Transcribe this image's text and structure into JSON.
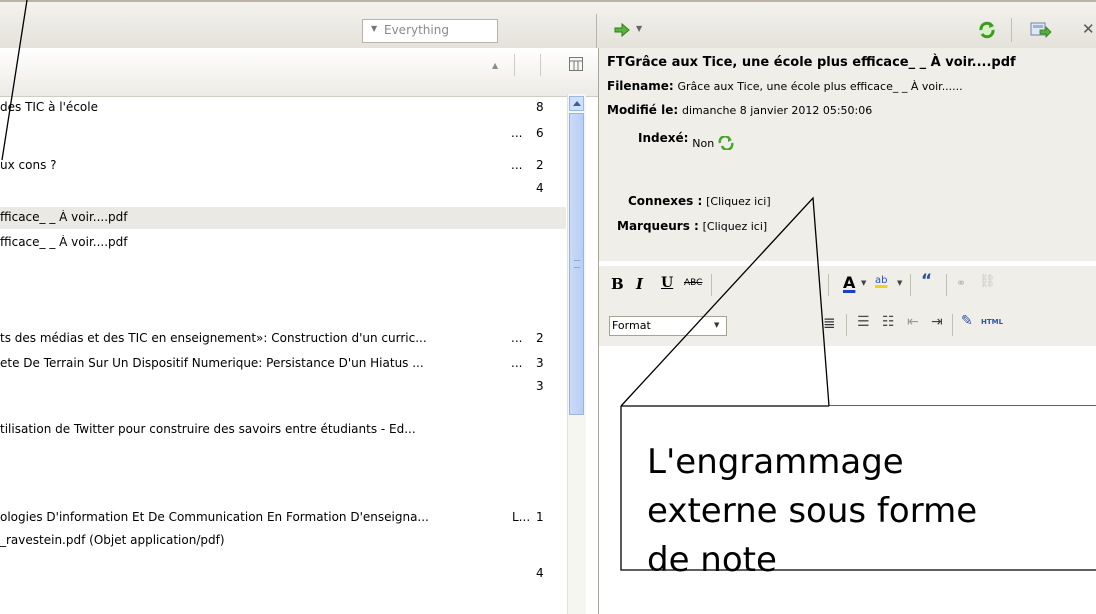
{
  "toolbar": {
    "search_mode": "Everything"
  },
  "items": [
    {
      "title": "des TIC à l'école",
      "meta": "",
      "count": "8"
    },
    {
      "title": "",
      "meta": "...",
      "count": "6"
    },
    {
      "title": "ux cons ?",
      "meta": "...",
      "count": "2"
    },
    {
      "title": "",
      "meta": "",
      "count": "4"
    },
    {
      "title": "fficace_ _ À voir....pdf",
      "meta": "",
      "count": "",
      "selected": true
    },
    {
      "title": "fficace_ _ À voir....pdf",
      "meta": "",
      "count": ""
    },
    {
      "title": "ts des médias et des TIC en enseignement»: Construction d'un curric...",
      "meta": "...",
      "count": "2"
    },
    {
      "title": "ete De Terrain Sur Un Dispositif Numerique: Persistance D'un Hiatus ...",
      "meta": "...",
      "count": "3"
    },
    {
      "title": "",
      "meta": "",
      "count": "3"
    },
    {
      "title": "tilisation de Twitter pour construire des savoirs entre étudiants - Ed...",
      "meta": "",
      "count": ""
    },
    {
      "title": "ologies D'information Et De Communication En Formation D'enseigna...",
      "meta": "L...",
      "count": "1"
    },
    {
      "title": "_ravestein.pdf (Objet application/pdf)",
      "meta": "",
      "count": ""
    },
    {
      "title": "",
      "meta": "",
      "count": "4"
    }
  ],
  "attachment": {
    "title": "FTGrâce aux Tice, une école plus efficace_ _ À voir....pdf",
    "filename_label": "Filename:",
    "filename_value": "Grâce aux Tice, une école plus efficace_ _ À voir......",
    "modified_label": "Modifié le:",
    "modified_value": "dimanche 8 janvier 2012 05:50:06",
    "indexed_label": "Indexé:",
    "indexed_value": "Non",
    "related_label": "Connexes :",
    "related_value": "[Cliquez ici]",
    "tags_label": "Marqueurs :",
    "tags_value": "[Cliquez ici]"
  },
  "editor": {
    "bold": "B",
    "italic": "I",
    "underline": "U",
    "strike": "ABC",
    "font_color": "A",
    "highlight": "ab",
    "quote": "66",
    "format_select": "Format",
    "html_btn": "HTML"
  },
  "callout": {
    "lines": [
      "L'engrammage",
      "externe sous forme",
      "de note"
    ]
  },
  "colors": {
    "selected_row": "#ebe9e3",
    "pane_bg": "#efeee8",
    "scroll_thumb": "#c9dbf9"
  }
}
